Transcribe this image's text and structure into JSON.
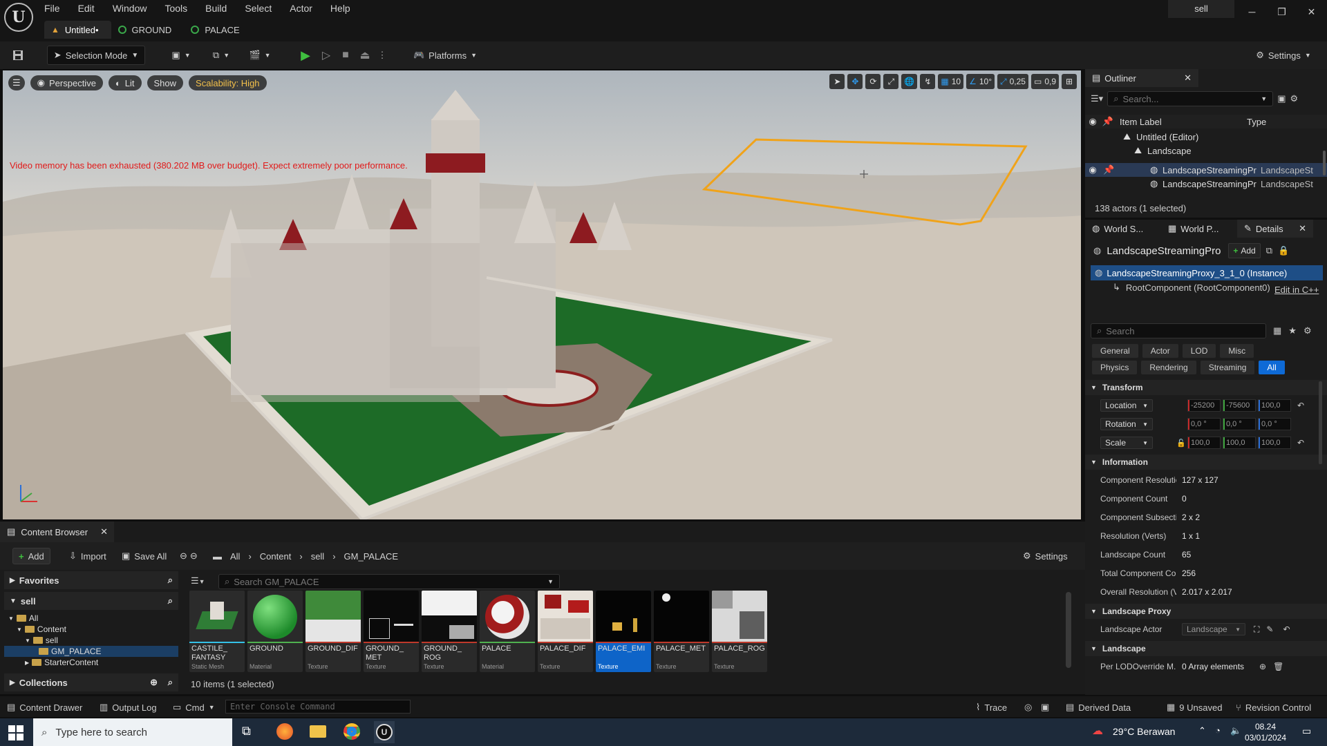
{
  "menu": [
    "File",
    "Edit",
    "Window",
    "Tools",
    "Build",
    "Select",
    "Actor",
    "Help"
  ],
  "doc_tabs": [
    {
      "label": "Untitled•",
      "active": true
    },
    {
      "label": "GROUND",
      "active": false
    },
    {
      "label": "PALACE",
      "active": false
    }
  ],
  "user": "sell",
  "toolbar": {
    "selection_mode": "Selection Mode",
    "platforms": "Platforms",
    "settings": "Settings"
  },
  "viewport": {
    "perspective": "Perspective",
    "lit": "Lit",
    "show": "Show",
    "scalability": "Scalability: High",
    "grid_snap": "10",
    "rot_snap": "10°",
    "scale_snap": "0,25",
    "cam_speed": "0,9",
    "warning": "Video memory has been exhausted (380.202 MB over budget). Expect extremely poor performance."
  },
  "content_browser": {
    "tab": "Content Browser",
    "add": "Add",
    "import": "Import",
    "save_all": "Save All",
    "breadcrumb": [
      "All",
      "Content",
      "sell",
      "GM_PALACE"
    ],
    "settings": "Settings",
    "favorites": "Favorites",
    "root": "sell",
    "tree": [
      "All",
      "Content",
      "sell",
      "GM_PALACE",
      "StarterContent"
    ],
    "collections": "Collections",
    "search_placeholder": "Search GM_PALACE",
    "assets": [
      {
        "name": "CASTILE_ FANTASY",
        "type": "Static Mesh",
        "bar": "#35c2e8"
      },
      {
        "name": "GROUND",
        "type": "Material",
        "bar": "#4fb24f"
      },
      {
        "name": "GROUND_DIF",
        "type": "Texture",
        "bar": "#c0392b"
      },
      {
        "name": "GROUND_ MET",
        "type": "Texture",
        "bar": "#c0392b"
      },
      {
        "name": "GROUND_ ROG",
        "type": "Texture",
        "bar": "#c0392b"
      },
      {
        "name": "PALACE",
        "type": "Material",
        "bar": "#4fb24f"
      },
      {
        "name": "PALACE_DIF",
        "type": "Texture",
        "bar": "#c0392b"
      },
      {
        "name": "PALACE_EMI",
        "type": "Texture",
        "bar": "#c0392b"
      },
      {
        "name": "PALACE_MET",
        "type": "Texture",
        "bar": "#c0392b"
      },
      {
        "name": "PALACE_ROG",
        "type": "Texture",
        "bar": "#c0392b"
      }
    ],
    "status": "10 items (1 selected)"
  },
  "statusbar": {
    "content_drawer": "Content Drawer",
    "output_log": "Output Log",
    "cmd": "Cmd",
    "console_placeholder": "Enter Console Command",
    "trace": "Trace",
    "derived_data": "Derived Data",
    "unsaved": "9 Unsaved",
    "revision": "Revision Control"
  },
  "outliner": {
    "tab": "Outliner",
    "search_placeholder": "Search...",
    "col_label": "Item Label",
    "col_type": "Type",
    "rows": [
      {
        "label": "Untitled (Editor)",
        "type": ""
      },
      {
        "label": "Landscape",
        "type": ""
      },
      {
        "label": "LandscapeStreamingPr",
        "type": "LandscapeSt"
      },
      {
        "label": "LandscapeStreamingPr",
        "type": "LandscapeSt"
      }
    ],
    "count": "138 actors (1 selected)"
  },
  "details": {
    "tabs": [
      "World S...",
      "World P...",
      "Details"
    ],
    "object_name": "LandscapeStreamingPro",
    "add": "Add",
    "instance": "LandscapeStreamingProxy_3_1_0 (Instance)",
    "root_component": "RootComponent (RootComponent0)",
    "edit_cpp": "Edit in C++",
    "search_placeholder": "Search",
    "filters_row1": [
      "General",
      "Actor",
      "LOD",
      "Misc"
    ],
    "filters_row2": [
      "Physics",
      "Rendering",
      "Streaming",
      "All"
    ],
    "transform_head": "Transform",
    "location_label": "Location",
    "location": [
      "-25200",
      "-75600",
      "100,0"
    ],
    "rotation_label": "Rotation",
    "rotation": [
      "0,0 °",
      "0,0 °",
      "0,0 °"
    ],
    "scale_label": "Scale",
    "scale": [
      "100,0",
      "100,0",
      "100,0"
    ],
    "information_head": "Information",
    "info": [
      {
        "name": "Component Resolutio",
        "value": "127 x 127"
      },
      {
        "name": "Component Count",
        "value": "0"
      },
      {
        "name": "Component Subsectic",
        "value": "2 x 2"
      },
      {
        "name": "Resolution (Verts)",
        "value": "1 x 1"
      },
      {
        "name": "Landscape Count",
        "value": "65"
      },
      {
        "name": "Total Component Cou",
        "value": "256"
      },
      {
        "name": "Overall Resolution (Ve",
        "value": "2.017 x 2.017"
      }
    ],
    "proxy_head": "Landscape Proxy",
    "landscape_actor_label": "Landscape Actor",
    "landscape_actor_value": "Landscape",
    "landscape_head": "Landscape",
    "lod_override_label": "Per LODOverride M...",
    "lod_override_value": "0 Array elements"
  },
  "taskbar": {
    "search": "Type here to search",
    "weather": "29°C  Berawan",
    "time": "08.24",
    "date": "03/01/2024"
  }
}
